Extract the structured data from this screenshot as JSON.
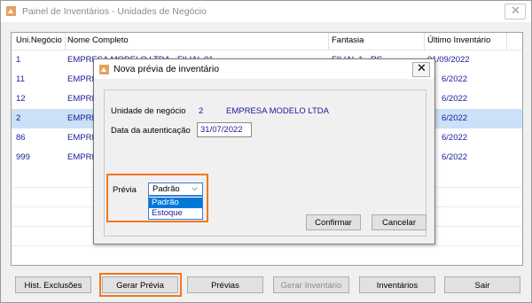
{
  "window": {
    "title": "Painel de Inventários - Unidades de Negócio",
    "close_glyph": "✕"
  },
  "grid": {
    "columns": [
      "Uni.Negócio",
      "Nome Completo",
      "Fantasia",
      "Último Inventário"
    ],
    "rows": [
      {
        "code": "1",
        "name": "EMPRESA MODELO LTDA - FILIAL 01",
        "fantasia": "FILIAL 1 - RS",
        "ultimo": "01/09/2022"
      },
      {
        "code": "11",
        "name": "EMPRE",
        "fantasia": "",
        "ultimo": "6/2022"
      },
      {
        "code": "12",
        "name": "EMPRE",
        "fantasia": "",
        "ultimo": "6/2022"
      },
      {
        "code": "2",
        "name": "EMPRE",
        "fantasia": "",
        "ultimo": "6/2022"
      },
      {
        "code": "86",
        "name": "EMPRE",
        "fantasia": "",
        "ultimo": "6/2022"
      },
      {
        "code": "999",
        "name": "EMPRE",
        "fantasia": "",
        "ultimo": "6/2022"
      }
    ],
    "selected_row": 3
  },
  "buttons": {
    "hist": "Hist. Exclusões",
    "gerar_previa": "Gerar Prévia",
    "previas": "Prévias",
    "gerar_inventario": "Gerar Inventário",
    "inventarios": "Inventários",
    "sair": "Sair"
  },
  "dialog": {
    "title": "Nova prévia de inventário",
    "close_glyph": "✕",
    "unidade_label": "Unidade de negócio",
    "unidade_code": "2",
    "unidade_name": "EMPRESA MODELO LTDA",
    "data_label": "Data da autenticação",
    "data_value": "31/07/2022",
    "previa_label": "Prévia",
    "previa_selected": "Padrão",
    "previa_options": [
      "Padrão",
      "Estoque"
    ],
    "confirmar": "Confirmar",
    "cancelar": "Cancelar"
  },
  "colors": {
    "highlight_orange": "#f07820",
    "selected_row": "#cce1f7",
    "text_blue": "#1a1a9c"
  }
}
